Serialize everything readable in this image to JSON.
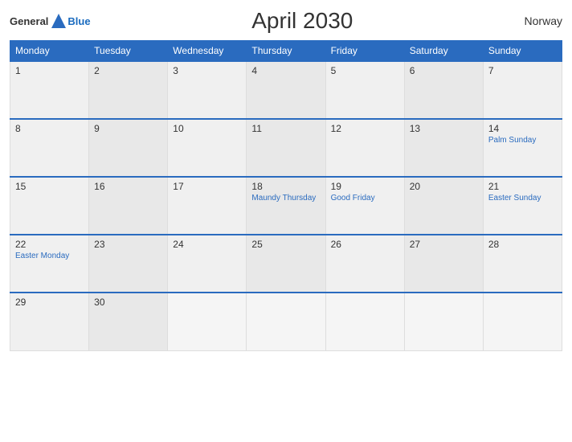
{
  "header": {
    "logo_general": "General",
    "logo_blue": "Blue",
    "title": "April 2030",
    "country": "Norway"
  },
  "days_of_week": [
    "Monday",
    "Tuesday",
    "Wednesday",
    "Thursday",
    "Friday",
    "Saturday",
    "Sunday"
  ],
  "weeks": [
    [
      {
        "day": "1",
        "holiday": ""
      },
      {
        "day": "2",
        "holiday": ""
      },
      {
        "day": "3",
        "holiday": ""
      },
      {
        "day": "4",
        "holiday": ""
      },
      {
        "day": "5",
        "holiday": ""
      },
      {
        "day": "6",
        "holiday": ""
      },
      {
        "day": "7",
        "holiday": ""
      }
    ],
    [
      {
        "day": "8",
        "holiday": ""
      },
      {
        "day": "9",
        "holiday": ""
      },
      {
        "day": "10",
        "holiday": ""
      },
      {
        "day": "11",
        "holiday": ""
      },
      {
        "day": "12",
        "holiday": ""
      },
      {
        "day": "13",
        "holiday": ""
      },
      {
        "day": "14",
        "holiday": "Palm Sunday"
      }
    ],
    [
      {
        "day": "15",
        "holiday": ""
      },
      {
        "day": "16",
        "holiday": ""
      },
      {
        "day": "17",
        "holiday": ""
      },
      {
        "day": "18",
        "holiday": "Maundy Thursday"
      },
      {
        "day": "19",
        "holiday": "Good Friday"
      },
      {
        "day": "20",
        "holiday": ""
      },
      {
        "day": "21",
        "holiday": "Easter Sunday"
      }
    ],
    [
      {
        "day": "22",
        "holiday": "Easter Monday"
      },
      {
        "day": "23",
        "holiday": ""
      },
      {
        "day": "24",
        "holiday": ""
      },
      {
        "day": "25",
        "holiday": ""
      },
      {
        "day": "26",
        "holiday": ""
      },
      {
        "day": "27",
        "holiday": ""
      },
      {
        "day": "28",
        "holiday": ""
      }
    ],
    [
      {
        "day": "29",
        "holiday": ""
      },
      {
        "day": "30",
        "holiday": ""
      },
      {
        "day": "",
        "holiday": ""
      },
      {
        "day": "",
        "holiday": ""
      },
      {
        "day": "",
        "holiday": ""
      },
      {
        "day": "",
        "holiday": ""
      },
      {
        "day": "",
        "holiday": ""
      }
    ]
  ]
}
